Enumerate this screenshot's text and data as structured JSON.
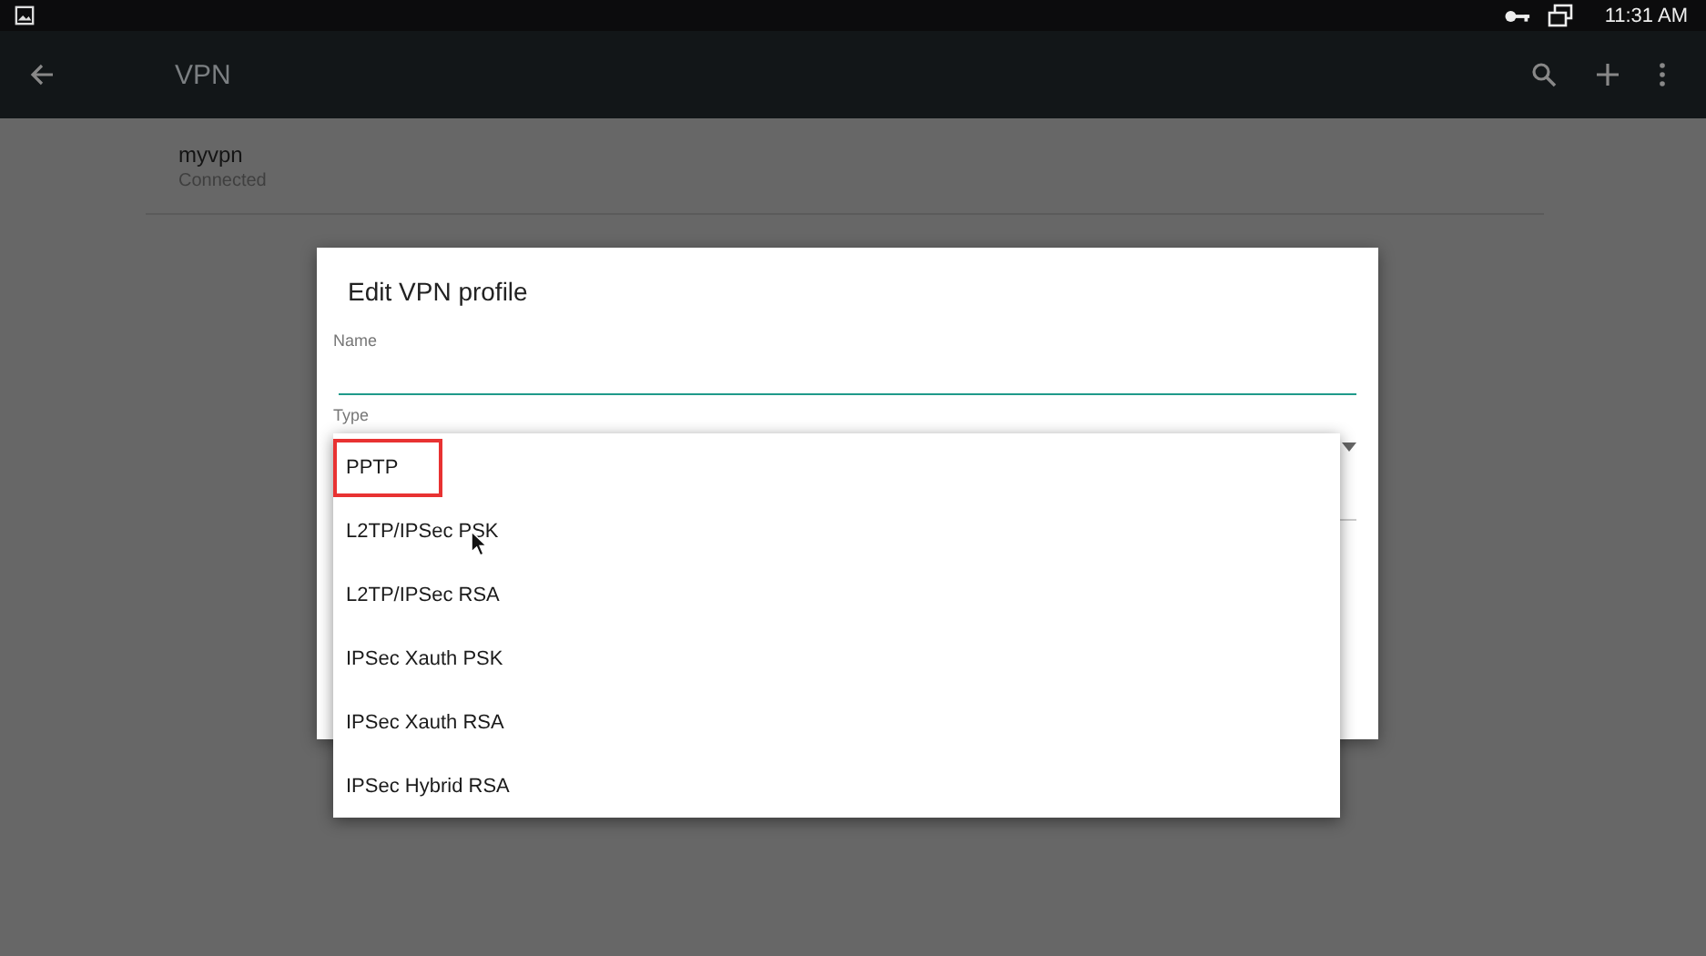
{
  "status_bar": {
    "time": "11:31 AM"
  },
  "app_bar": {
    "title": "VPN"
  },
  "vpn_list": [
    {
      "name": "myvpn",
      "status": "Connected"
    }
  ],
  "dialog": {
    "title": "Edit VPN profile",
    "fields": [
      {
        "label": "Name",
        "kind": "text"
      },
      {
        "label": "Type",
        "kind": "dropdown"
      }
    ]
  },
  "dropdown": {
    "options": [
      {
        "label": "PPTP",
        "marked": true
      },
      {
        "label": "L2TP/IPSec PSK",
        "marked": false
      },
      {
        "label": "L2TP/IPSec RSA",
        "marked": false
      },
      {
        "label": "IPSec Xauth PSK",
        "marked": false
      },
      {
        "label": "IPSec Xauth RSA",
        "marked": false
      },
      {
        "label": "IPSec Hybrid RSA",
        "marked": false
      }
    ]
  }
}
